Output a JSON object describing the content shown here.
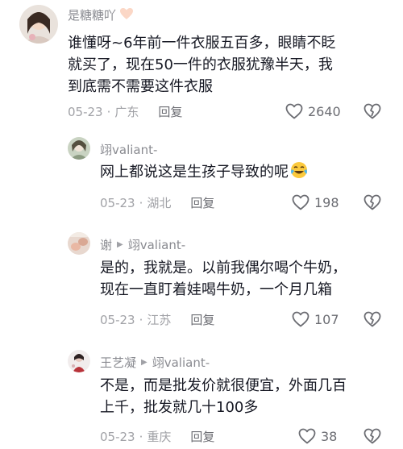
{
  "comments": [
    {
      "username": "是糖糖吖",
      "text_lines": [
        "谁懂呀~6年前一件衣服五百多，眼睛不眨",
        "就买了，现在50一件的衣服犹豫半天，我",
        "到底需不需要这件衣服"
      ],
      "date": "05-23",
      "location": "广东",
      "reply_label": "回复",
      "likes": "2640"
    },
    {
      "username": "翊valiant-",
      "text_lines": [
        "网上都说这是生孩子导致的呢"
      ],
      "date": "05-23",
      "location": "湖北",
      "reply_label": "回复",
      "likes": "198"
    },
    {
      "username": "谢",
      "reply_to": "翊valiant-",
      "text_lines": [
        "是的，我就是。以前我偶尔喝个牛奶，",
        "现在一直盯着娃喝牛奶，一个月几箱"
      ],
      "date": "05-23",
      "location": "江苏",
      "reply_label": "回复",
      "likes": "107"
    },
    {
      "username": "王艺凝",
      "reply_to": "翊valiant-",
      "text_lines": [
        "不是，而是批发价就很便宜，外面几百",
        "上千，批发就几十100多"
      ],
      "date": "05-23",
      "location": "重庆",
      "reply_label": "回复",
      "likes": "38"
    }
  ],
  "colors": {
    "text": "#161823",
    "username": "#8a8b91",
    "meta": "#a0a1a6",
    "icon": "#6b6c72"
  },
  "icons": [
    "heart-emoji",
    "laughing-emoji",
    "reply-arrow-icon",
    "like-heart-icon",
    "dislike-heart-icon"
  ]
}
